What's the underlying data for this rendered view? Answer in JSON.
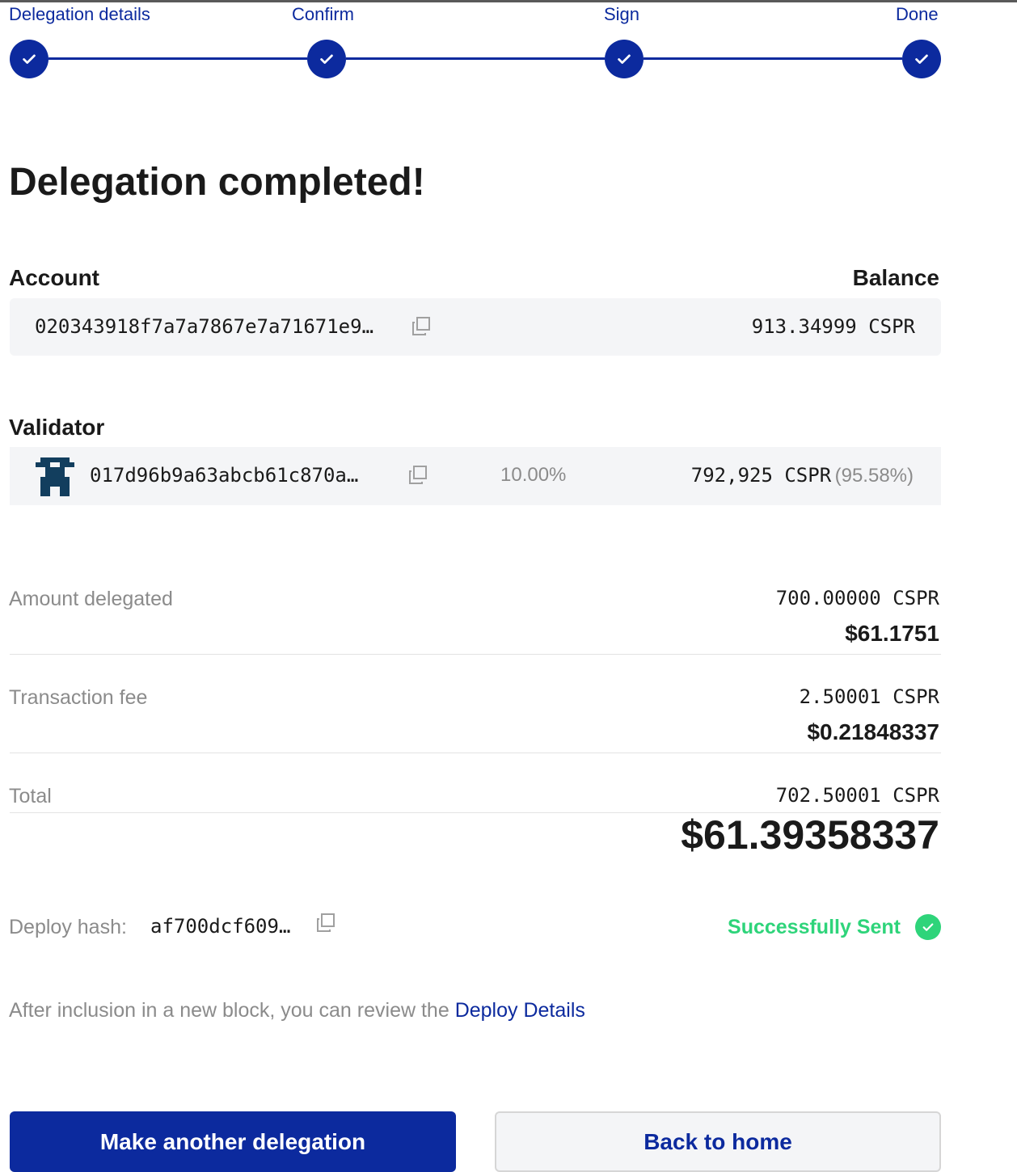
{
  "stepper": {
    "steps": [
      {
        "label": "Delegation details"
      },
      {
        "label": "Confirm"
      },
      {
        "label": "Sign"
      },
      {
        "label": "Done"
      }
    ]
  },
  "title": "Delegation completed!",
  "account": {
    "label": "Account",
    "balance_label": "Balance",
    "address": "020343918f7a7a7867e7a71671e9…",
    "balance": "913.34999 CSPR"
  },
  "validator": {
    "label": "Validator",
    "address": "017d96b9a63abcb61c870a…",
    "fee": "10.00%",
    "stake": "792,925 CSPR",
    "stake_share": "(95.58%)"
  },
  "summary": {
    "amount": {
      "label": "Amount delegated",
      "cspr": "700.00000 CSPR",
      "usd": "$61.1751"
    },
    "fee": {
      "label": "Transaction fee",
      "cspr": "2.50001 CSPR",
      "usd": "$0.21848337"
    },
    "total": {
      "label": "Total",
      "cspr": "702.50001 CSPR",
      "usd": "$61.39358337"
    }
  },
  "deploy": {
    "label": "Deploy hash:",
    "hash": "af700dcf609…",
    "status": "Successfully Sent"
  },
  "note": {
    "text": "After inclusion in a new block, you can review the ",
    "link": "Deploy Details"
  },
  "buttons": {
    "primary": "Make another delegation",
    "secondary": "Back to home"
  },
  "colors": {
    "accent": "#0c2a9e",
    "success": "#2ed47a",
    "muted": "#8b8b8b",
    "card_bg": "#f4f5f7"
  }
}
